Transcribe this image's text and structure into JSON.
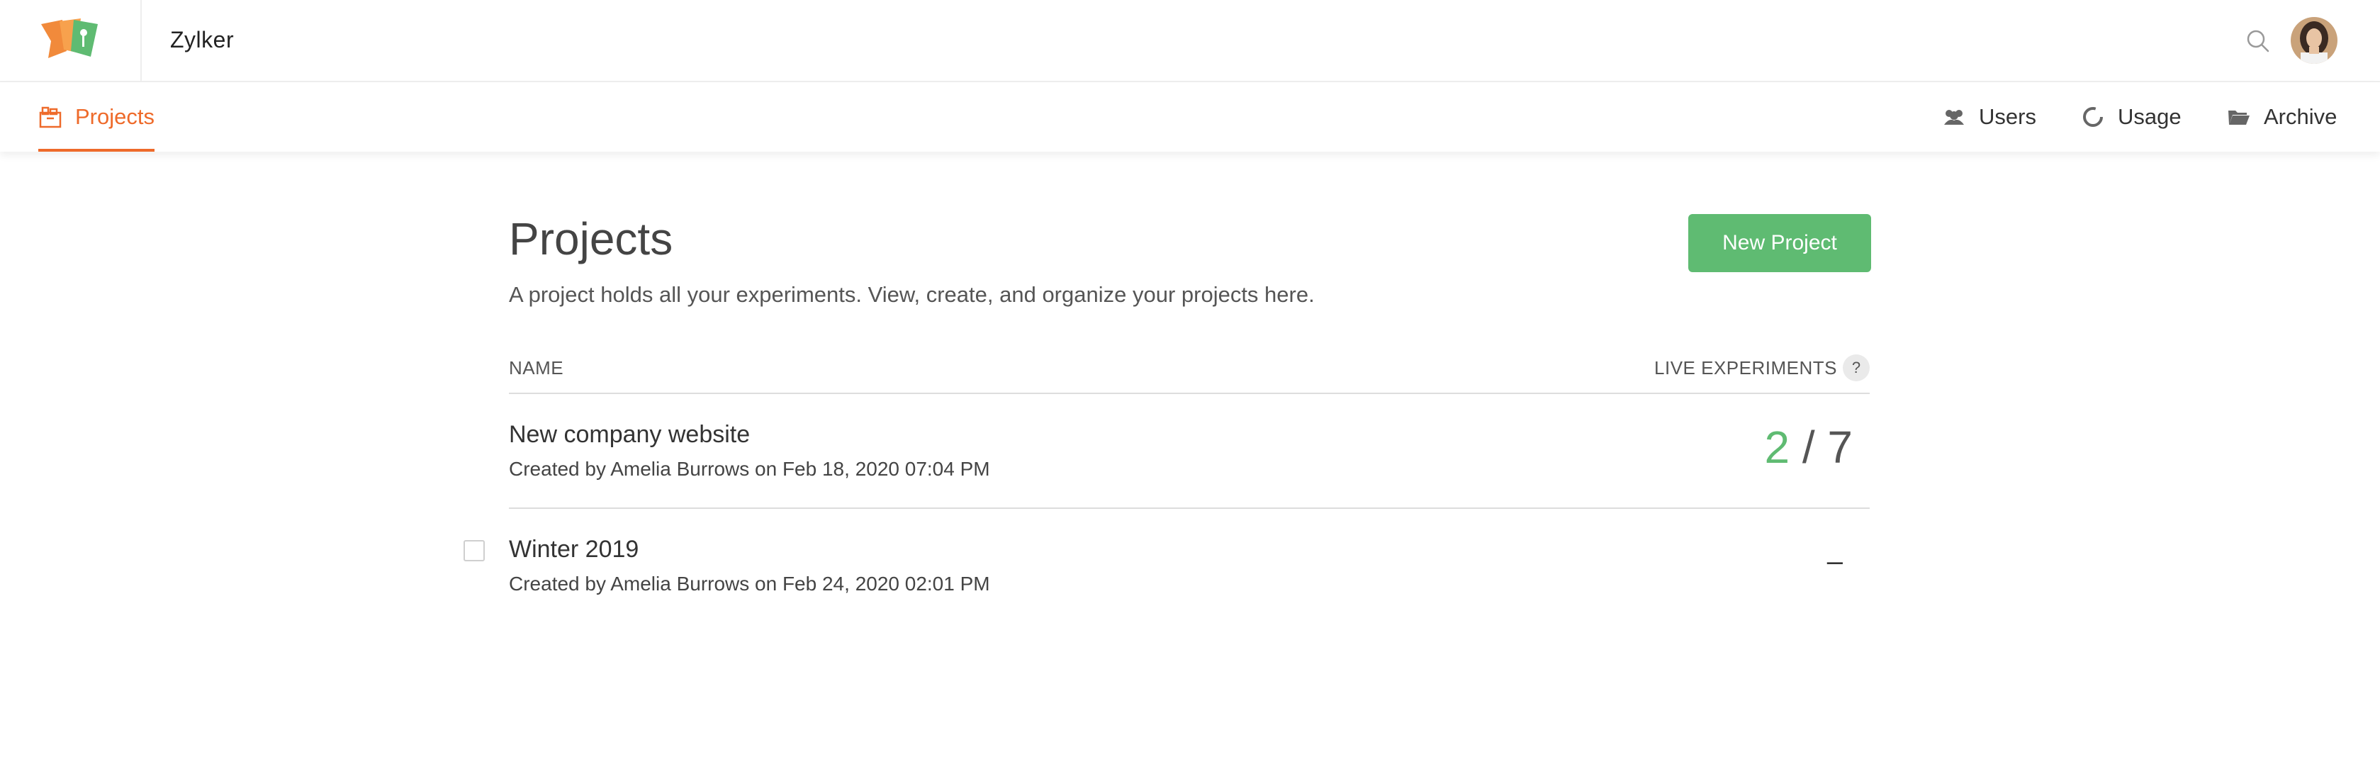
{
  "header": {
    "org_name": "Zylker",
    "search_icon": "search-icon",
    "avatar_icon": "user-avatar"
  },
  "nav": {
    "tabs": [
      {
        "label": "Projects",
        "icon": "projects-icon",
        "active": true
      },
      {
        "label": "Users",
        "icon": "users-icon"
      },
      {
        "label": "Usage",
        "icon": "usage-icon"
      },
      {
        "label": "Archive",
        "icon": "folder-icon"
      }
    ]
  },
  "main": {
    "title": "Projects",
    "description": "A project holds all your experiments. View, create, and organize your projects here.",
    "new_project_label": "New Project",
    "columns": {
      "name": "NAME",
      "live_experiments": "LIVE EXPERIMENTS",
      "help": "?"
    },
    "projects": [
      {
        "name": "New company website",
        "meta": "Created by Amelia Burrows on Feb 18, 2020 07:04 PM",
        "live": "2",
        "separator": "/",
        "total": "7"
      },
      {
        "name": "Winter 2019",
        "meta": "Created by Amelia Burrows on Feb 24, 2020 02:01 PM",
        "live_placeholder": "–"
      }
    ]
  },
  "colors": {
    "accent_orange": "#ee6a2a",
    "accent_green": "#5fbb72"
  }
}
